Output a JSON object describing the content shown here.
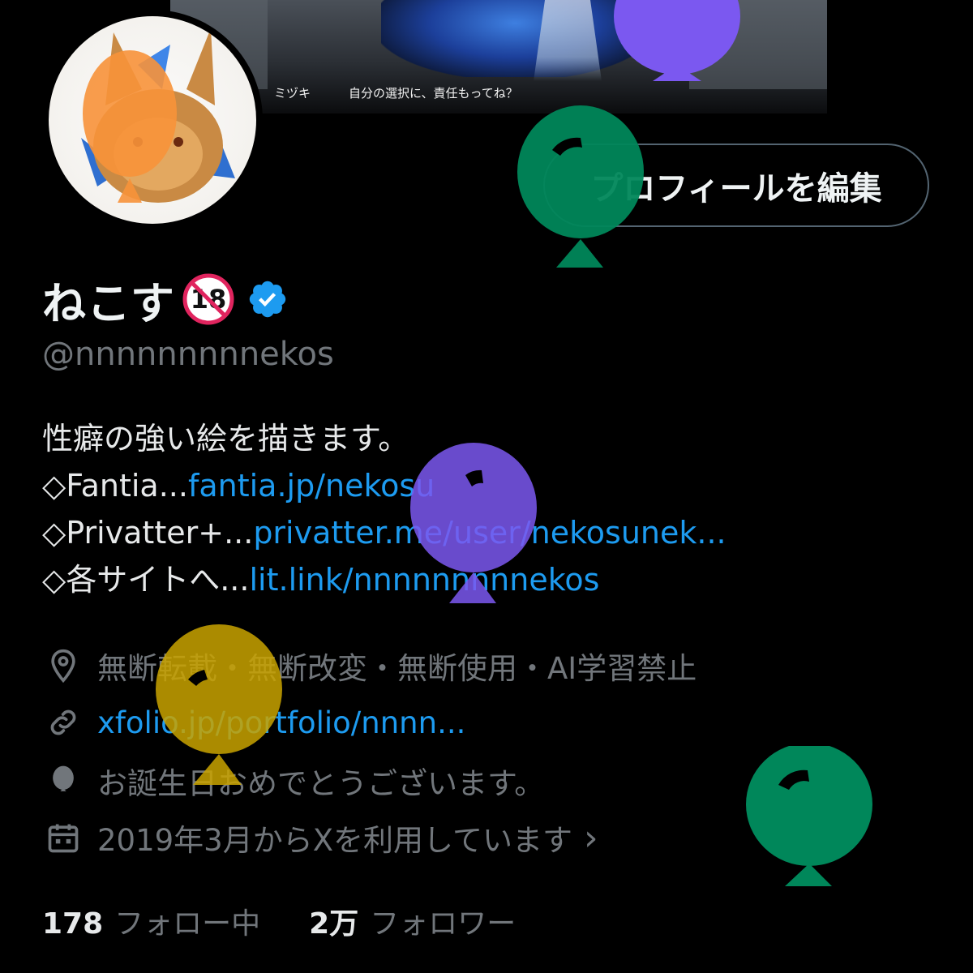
{
  "banner": {
    "caption_name": "ミヅキ",
    "caption_line": "自分の選択に、責任もってね？"
  },
  "profile": {
    "edit_button_label": "プロフィールを編集",
    "display_name": "ねこす",
    "r18_badge": "18",
    "verified_icon": "verified-badge-icon",
    "handle": "@nnnnnnnnnekos"
  },
  "bio": {
    "line1": "性癖の強い絵を描きます。",
    "line2_prefix": "◇Fantia...",
    "line2_link": "fantia.jp/nekosu",
    "line3_prefix": "◇Privatter+...",
    "line3_link": "privatter.me/user/nekosunek...",
    "line4_prefix": "◇各サイトへ...",
    "line4_link": "lit.link/nnnnnnnnnekos"
  },
  "meta": {
    "location": "無断転載・無断改変・無断使用・AI学習禁止",
    "website": "xfolio.jp/portfolio/nnnn...",
    "birthday": "お誕生日おめでとうございます。",
    "joined": "2019年3月からXを利用しています",
    "joined_chevron": "›",
    "icons": [
      "location-pin-icon",
      "link-icon",
      "balloon-icon",
      "calendar-icon"
    ]
  },
  "stats": {
    "following_count": "178",
    "following_label": "フォロー中",
    "followers_count": "2万",
    "followers_label": "フォロワー"
  },
  "colors": {
    "background": "#000000",
    "link": "#1d9bf0",
    "muted": "#71767b",
    "verified": "#1d9bf0",
    "balloons": [
      "#f7923a",
      "#7b58f0",
      "#00875a",
      "#7b58f0",
      "#c9a300",
      "#00875a"
    ]
  }
}
